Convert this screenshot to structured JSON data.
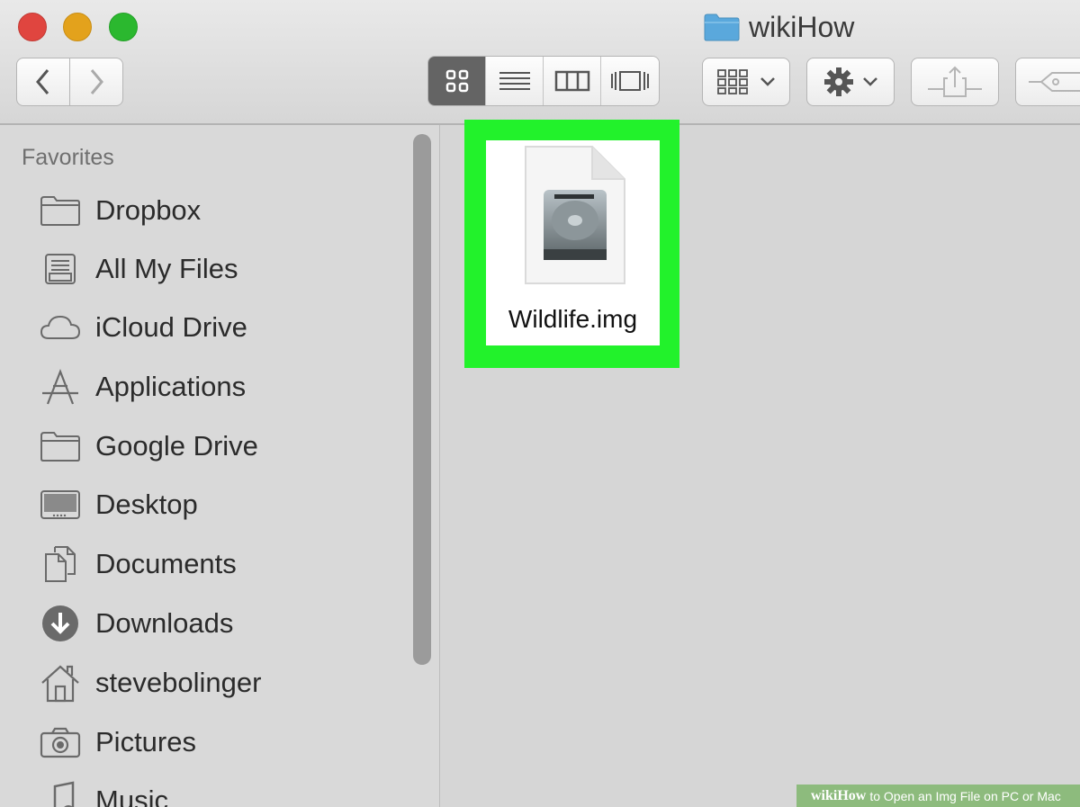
{
  "window": {
    "title": "wikiHow"
  },
  "toolbar": {
    "back_icon": "chevron-left-icon",
    "forward_icon": "chevron-right-icon",
    "view_modes": [
      "icon-view-icon",
      "list-view-icon",
      "column-view-icon",
      "cover-flow-icon"
    ],
    "active_view": "icon-view-icon",
    "arrange_icon": "arrange-grid-icon",
    "action_icon": "gear-icon",
    "share_icon": "share-icon",
    "tag_icon": "tag-icon"
  },
  "sidebar": {
    "heading": "Favorites",
    "items": [
      {
        "label": "Dropbox",
        "icon": "folder-icon"
      },
      {
        "label": "All My Files",
        "icon": "all-files-icon"
      },
      {
        "label": "iCloud Drive",
        "icon": "cloud-icon"
      },
      {
        "label": "Applications",
        "icon": "applications-icon"
      },
      {
        "label": "Google Drive",
        "icon": "folder-icon"
      },
      {
        "label": "Desktop",
        "icon": "desktop-icon"
      },
      {
        "label": "Documents",
        "icon": "documents-icon"
      },
      {
        "label": "Downloads",
        "icon": "downloads-icon"
      },
      {
        "label": "stevebolinger",
        "icon": "home-icon"
      },
      {
        "label": "Pictures",
        "icon": "camera-icon"
      },
      {
        "label": "Music",
        "icon": "music-icon"
      }
    ]
  },
  "content": {
    "files": [
      {
        "name": "Wildlife.img",
        "icon": "disk-image-icon"
      }
    ],
    "highlight_color": "#22f22b"
  },
  "watermark": {
    "brand_wiki": "wiki",
    "brand_how": "How",
    "text": "to Open an Img File on PC or Mac"
  }
}
